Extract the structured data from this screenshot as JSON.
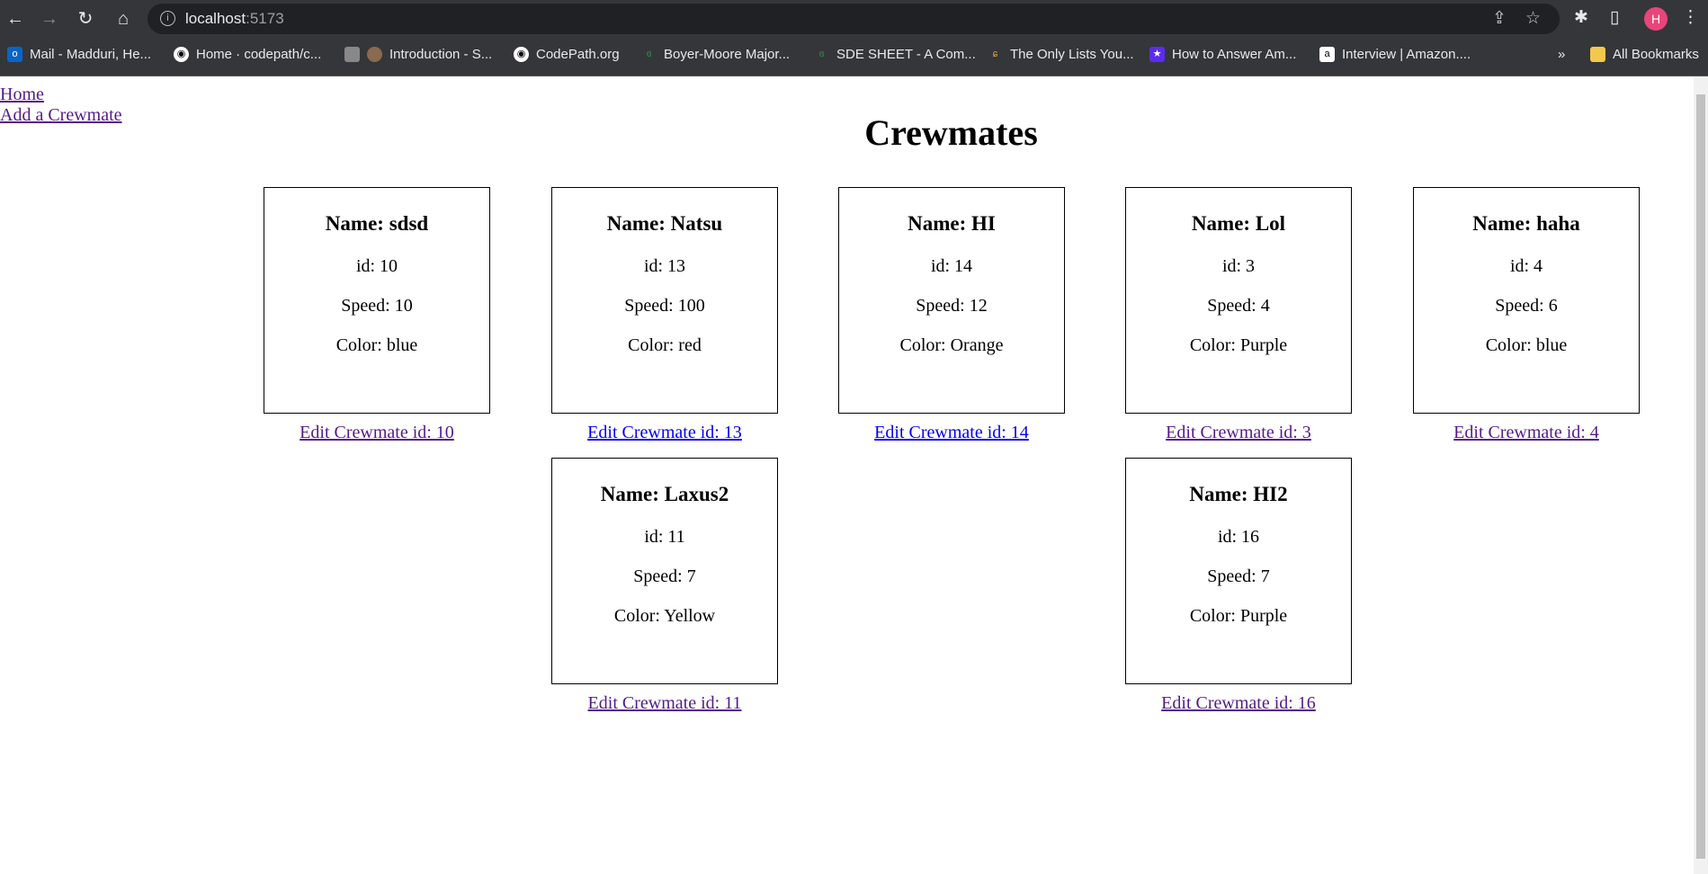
{
  "browser": {
    "url_host": "localhost",
    "url_port": ":5173",
    "profile_initial": "H",
    "bookmarks": [
      "Mail - Madduri, He...",
      "Home · codepath/c...",
      "Introduction - S...",
      "CodePath.org",
      "Boyer-Moore Major...",
      "SDE SHEET - A Com...",
      "The Only Lists You...",
      "How to Answer Am...",
      "Interview | Amazon...."
    ],
    "more": "»",
    "all_bookmarks": "All Bookmarks"
  },
  "nav": {
    "home": "Home",
    "add": "Add a Crewmate"
  },
  "page": {
    "title": "Crewmates"
  },
  "crewmates": [
    {
      "name": "Name: sdsd",
      "id": "id: 10",
      "speed": "Speed: 10",
      "color": "Color: blue",
      "edit": "Edit Crewmate id: 10"
    },
    {
      "name": "Name: Natsu",
      "id": "id: 13",
      "speed": "Speed: 100",
      "color": "Color: red",
      "edit": "Edit Crewmate id: 13"
    },
    {
      "name": "Name: HI",
      "id": "id: 14",
      "speed": "Speed: 12",
      "color": "Color: Orange",
      "edit": "Edit Crewmate id: 14"
    },
    {
      "name": "Name: Lol",
      "id": "id: 3",
      "speed": "Speed: 4",
      "color": "Color: Purple",
      "edit": "Edit Crewmate id: 3"
    },
    {
      "name": "Name: haha",
      "id": "id: 4",
      "speed": "Speed: 6",
      "color": "Color: blue",
      "edit": "Edit Crewmate id: 4"
    },
    {
      "name": "Name: Laxus2",
      "id": "id: 11",
      "speed": "Speed: 7",
      "color": "Color: Yellow",
      "edit": "Edit Crewmate id: 11"
    },
    {
      "name": "Name: HI2",
      "id": "id: 16",
      "speed": "Speed: 7",
      "color": "Color: Purple",
      "edit": "Edit Crewmate id: 16"
    }
  ]
}
